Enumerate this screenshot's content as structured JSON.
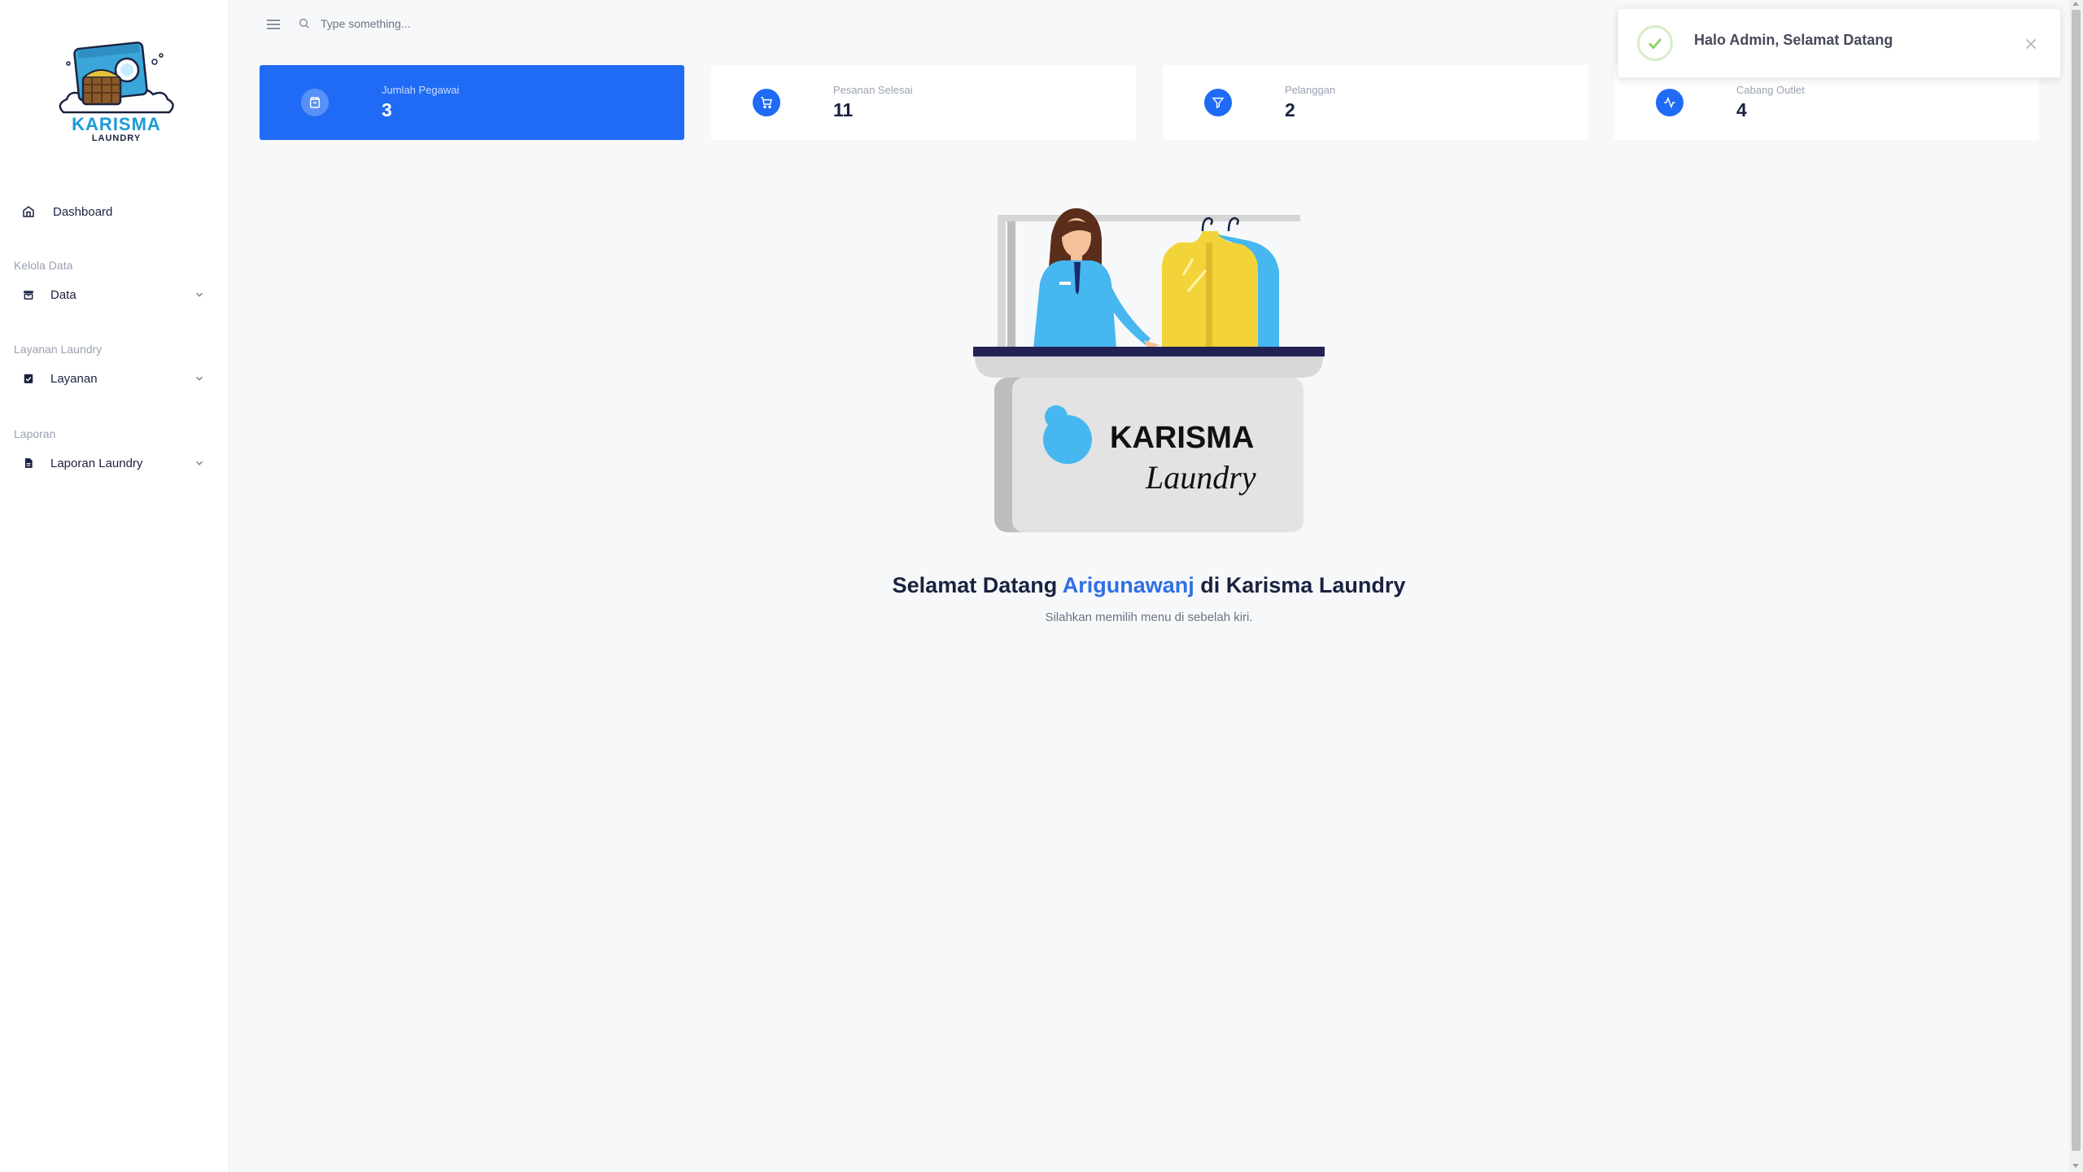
{
  "brand": {
    "name": "KARISMA",
    "sub": "LAUNDRY",
    "illustration_text_1": "KARISMA",
    "illustration_text_2": "Laundry"
  },
  "sidebar": {
    "dashboard": {
      "label": "Dashboard",
      "icon": "home-icon"
    },
    "sections": [
      {
        "title": "Kelola Data",
        "item": {
          "label": "Data",
          "icon": "archive-icon"
        }
      },
      {
        "title": "Layanan Laundry",
        "item": {
          "label": "Layanan",
          "icon": "clipboard-icon"
        }
      },
      {
        "title": "Laporan",
        "item": {
          "label": "Laporan Laundry",
          "icon": "file-icon"
        }
      }
    ]
  },
  "topbar": {
    "search_placeholder": "Type something..."
  },
  "stats": [
    {
      "label": "Jumlah Pegawai",
      "value": "3",
      "icon": "shopping-bag-icon"
    },
    {
      "label": "Pesanan Selesai",
      "value": "11",
      "icon": "cart-icon"
    },
    {
      "label": "Pelanggan",
      "value": "2",
      "icon": "filter-icon"
    },
    {
      "label": "Cabang Outlet",
      "value": "4",
      "icon": "activity-icon"
    }
  ],
  "welcome": {
    "prefix": "Selamat Datang",
    "name": "Arigunawanj",
    "suffix": "di Karisma Laundry",
    "subtitle": "Silahkan memilih menu di sebelah kiri."
  },
  "toast": {
    "message": "Halo Admin, Selamat Datang"
  },
  "colors": {
    "primary": "#1f6bf5",
    "accent_name": "#2f6fe6",
    "success": "#8cd56b"
  }
}
